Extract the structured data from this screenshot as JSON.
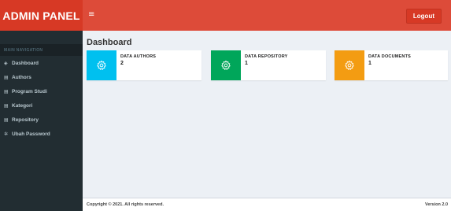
{
  "header": {
    "logo_text": "ADMIN PANEL",
    "menu_toggle_glyph": "≡",
    "logout_label": "Logout",
    "color_header": "#dd4b39",
    "color_logo": "#d73925"
  },
  "sidebar": {
    "header": "MAIN NAVIGATION",
    "items": [
      {
        "label": "Dashboard",
        "icon": "dashboard-icon",
        "glyph": "◈"
      },
      {
        "label": "Authors",
        "icon": "book-icon",
        "glyph": "▤"
      },
      {
        "label": "Program Studi",
        "icon": "book-icon",
        "glyph": "▤"
      },
      {
        "label": "Kategori",
        "icon": "book-icon",
        "glyph": "▤"
      },
      {
        "label": "Repository",
        "icon": "book-icon",
        "glyph": "▤"
      },
      {
        "label": "Ubah Password",
        "icon": "gear-icon",
        "glyph": "✲"
      }
    ]
  },
  "main": {
    "title": "Dashboard",
    "boxes": [
      {
        "label": "DATA AUTHORS",
        "value": "2",
        "icon": "gear-icon",
        "color": "#00c0ef"
      },
      {
        "label": "DATA REPOSITORY",
        "value": "1",
        "icon": "gear-icon",
        "color": "#00a65a"
      },
      {
        "label": "DATA DOCUMENTS",
        "value": "1",
        "icon": "gear-icon",
        "color": "#f39c12"
      }
    ]
  },
  "footer": {
    "copyright": "Copyright © 2021. All rights reserved.",
    "version": "Version 2.0"
  }
}
